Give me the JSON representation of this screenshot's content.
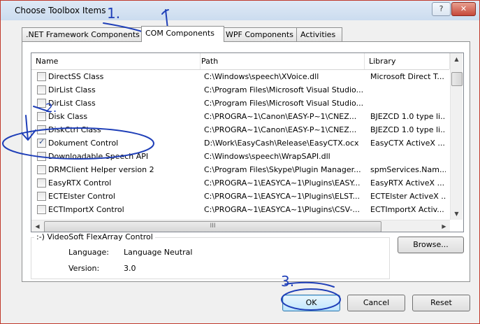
{
  "window": {
    "title": "Choose Toolbox Items",
    "help_glyph": "?",
    "close_glyph": "✕"
  },
  "tabs": [
    {
      "label": ".NET Framework Components",
      "active": false
    },
    {
      "label": "COM Components",
      "active": true
    },
    {
      "label": "WPF Components",
      "active": false
    },
    {
      "label": "Activities",
      "active": false
    }
  ],
  "columns": {
    "name": "Name",
    "path": "Path",
    "library": "Library"
  },
  "rows": [
    {
      "name": "DirectSS Class",
      "path": "C:\\Windows\\speech\\XVoice.dll",
      "library": "Microsoft Direct T...",
      "checked": false
    },
    {
      "name": "DirList Class",
      "path": "C:\\Program Files\\Microsoft Visual Studio...",
      "library": "",
      "checked": false
    },
    {
      "name": "DirList Class",
      "path": "C:\\Program Files\\Microsoft Visual Studio...",
      "library": "",
      "checked": false
    },
    {
      "name": "Disk Class",
      "path": "C:\\PROGRA~1\\Canon\\EASY-P~1\\CNEZ...",
      "library": "BJEZCD 1.0 type li...",
      "checked": false
    },
    {
      "name": "DiskCtrl Class",
      "path": "C:\\PROGRA~1\\Canon\\EASY-P~1\\CNEZ...",
      "library": "BJEZCD 1.0 type li...",
      "checked": false
    },
    {
      "name": "Dokument Control",
      "path": "D:\\Work\\EasyCash\\Release\\EasyCTX.ocx",
      "library": "EasyCTX ActiveX ...",
      "checked": true
    },
    {
      "name": "Downloadable Speech API",
      "path": "C:\\Windows\\speech\\WrapSAPI.dll",
      "library": "",
      "checked": false
    },
    {
      "name": "DRMClient Helper version 2",
      "path": "C:\\Program Files\\Skype\\Plugin Manager...",
      "library": "spmServices.Nam...",
      "checked": false
    },
    {
      "name": "EasyRTX Control",
      "path": "C:\\PROGRA~1\\EASYCA~1\\Plugins\\EASY...",
      "library": "EasyRTX ActiveX ...",
      "checked": false
    },
    {
      "name": "ECTElster Control",
      "path": "C:\\PROGRA~1\\EASYCA~1\\Plugins\\ELST...",
      "library": "ECTElster ActiveX ...",
      "checked": false
    },
    {
      "name": "ECTImportX Control",
      "path": "C:\\PROGRA~1\\EASYCA~1\\Plugins\\CSV-...",
      "library": "ECTImportX Activ...",
      "checked": false
    }
  ],
  "scroll": {
    "up": "▲",
    "down": "▼",
    "left": "◀",
    "right": "▶",
    "grip": "III"
  },
  "details": {
    "legend": ":-) VideoSoft FlexArray Control",
    "language_label": "Language:",
    "language_value": "Language Neutral",
    "version_label": "Version:",
    "version_value": "3.0"
  },
  "buttons": {
    "browse": "Browse...",
    "ok": "OK",
    "cancel": "Cancel",
    "reset": "Reset"
  },
  "annotations": {
    "step1": "1.",
    "step2": "2.",
    "step3": "3.",
    "ink_color": "#1f3fb8"
  }
}
